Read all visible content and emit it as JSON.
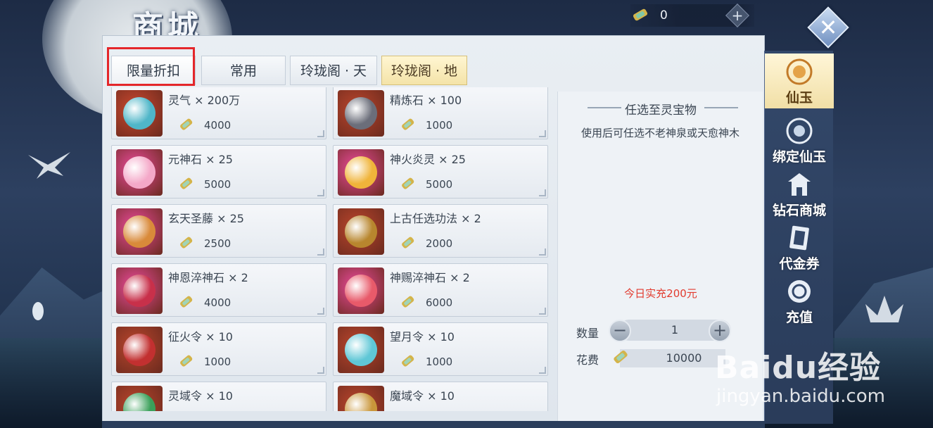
{
  "title": "商城",
  "currency": {
    "icon": "jade-scroll-icon",
    "value": "0"
  },
  "tabs": [
    {
      "label": "限量折扣",
      "active": true
    },
    {
      "label": "常用",
      "active": false
    },
    {
      "label": "玲珑阁 · 天",
      "active": false
    },
    {
      "label": "玲珑阁 · 地",
      "active": false
    }
  ],
  "items": [
    {
      "name": "灵气 × 200万",
      "price": "4000",
      "icon": "spiral-essence-icon",
      "bg": "#c9472e",
      "inner": "#4fb6c8"
    },
    {
      "name": "精炼石 × 100",
      "price": "1000",
      "icon": "treasure-chest-icon",
      "bg": "#b9452c",
      "inner": "#6b6e7a"
    },
    {
      "name": "元神石 × 25",
      "price": "5000",
      "icon": "pink-gem-icon",
      "bg": "#e94a9a",
      "inner": "#f4a8c8"
    },
    {
      "name": "神火炎灵 × 25",
      "price": "5000",
      "icon": "fire-spirit-icon",
      "bg": "#e94a9a",
      "inner": "#f0b43a"
    },
    {
      "name": "玄天圣藤 × 25",
      "price": "2500",
      "icon": "vine-icon",
      "bg": "#e94a9a",
      "inner": "#d98a3a"
    },
    {
      "name": "上古任选功法 × 2",
      "price": "2000",
      "icon": "chest-icon",
      "bg": "#b9452c",
      "inner": "#b8862e"
    },
    {
      "name": "神恩淬神石 × 2",
      "price": "4000",
      "icon": "crystal-icon",
      "bg": "#e94a9a",
      "inner": "#c8304a"
    },
    {
      "name": "神赐淬神石 × 2",
      "price": "6000",
      "icon": "crystal-gold-icon",
      "bg": "#e94a9a",
      "inner": "#e85a6a"
    },
    {
      "name": "征火令 × 10",
      "price": "1000",
      "icon": "fire-token-icon",
      "bg": "#b9452c",
      "inner": "#c23030"
    },
    {
      "name": "望月令 × 10",
      "price": "1000",
      "icon": "moon-token-icon",
      "bg": "#b9452c",
      "inner": "#5fc7d6"
    },
    {
      "name": "灵域令 × 10",
      "price": "",
      "icon": "spirit-token-icon",
      "bg": "#b9452c",
      "inner": "#3aa05a"
    },
    {
      "name": "魔域令 × 10",
      "price": "",
      "icon": "demon-token-icon",
      "bg": "#b9452c",
      "inner": "#c9963a"
    }
  ],
  "detail": {
    "title": "任选至灵宝物",
    "description": "使用后可任选不老神泉或天愈神木",
    "recharge_note": "今日实充200元",
    "quantity_label": "数量",
    "quantity_value": "1",
    "cost_label": "花费",
    "cost_value": "10000"
  },
  "sidebar": [
    {
      "label": "仙玉",
      "icon": "jade-orb-icon",
      "active": true
    },
    {
      "label": "绑定仙玉",
      "icon": "bound-jade-icon",
      "active": false
    },
    {
      "label": "钻石商城",
      "icon": "pavilion-icon",
      "active": false
    },
    {
      "label": "代金券",
      "icon": "voucher-icon",
      "active": false
    },
    {
      "label": "充值",
      "icon": "recharge-icon",
      "active": false
    }
  ],
  "watermark": {
    "logo": "Baidu经验",
    "url": "jingyan.baidu.com"
  },
  "colors": {
    "accent_gold": "#f1dfa6",
    "sidebar": "#2f4363",
    "highlight_red": "#e4262a",
    "note_red": "#e23b2f"
  }
}
